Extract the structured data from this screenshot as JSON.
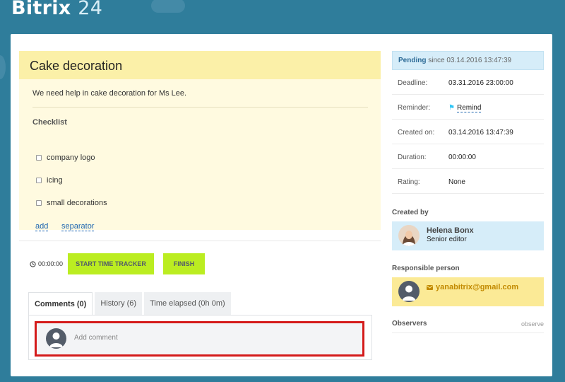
{
  "app": {
    "brand": "Bitrix",
    "brand_num": "24"
  },
  "task": {
    "title": "Cake decoration",
    "description": "We need help in cake decoration for Ms Lee.",
    "checklist_title": "Checklist",
    "checklist": [
      {
        "label": "company logo",
        "checked": false
      },
      {
        "label": "icing",
        "checked": false
      },
      {
        "label": "small decorations",
        "checked": false
      }
    ],
    "add_link": "add",
    "separator_link": "separator"
  },
  "tracker": {
    "time": "00:00:00",
    "start_label": "START TIME TRACKER",
    "finish_label": "FINISH"
  },
  "tabs": [
    {
      "label": "Comments (0)",
      "active": true
    },
    {
      "label": "History (6)",
      "active": false
    },
    {
      "label": "Time elapsed (0h 0m)",
      "active": false
    }
  ],
  "comment": {
    "placeholder": "Add comment"
  },
  "sidebar": {
    "status": "Pending",
    "status_since": "since 03.14.2016 13:47:39",
    "props": [
      {
        "label": "Deadline:",
        "value": "03.31.2016 23:00:00"
      },
      {
        "label": "Reminder:",
        "value": "Remind"
      },
      {
        "label": "Created on:",
        "value": "03.14.2016 13:47:39"
      },
      {
        "label": "Duration:",
        "value": "00:00:00"
      },
      {
        "label": "Rating:",
        "value": "None"
      }
    ],
    "created_by_title": "Created by",
    "creator": {
      "name": "Helena Bonx",
      "role": "Senior editor"
    },
    "responsible_title": "Responsible person",
    "responsible": {
      "email": "yanabitrix@gmail.com"
    },
    "observers_title": "Observers",
    "observers_link": "observe"
  },
  "colors": {
    "background": "#2f7d9b",
    "task_header": "#fbf0a8",
    "accent_green": "#bbed21",
    "highlight_red": "#d41a1a",
    "status_blue": "#d6edf9",
    "responsible_yellow": "#fbea96"
  }
}
